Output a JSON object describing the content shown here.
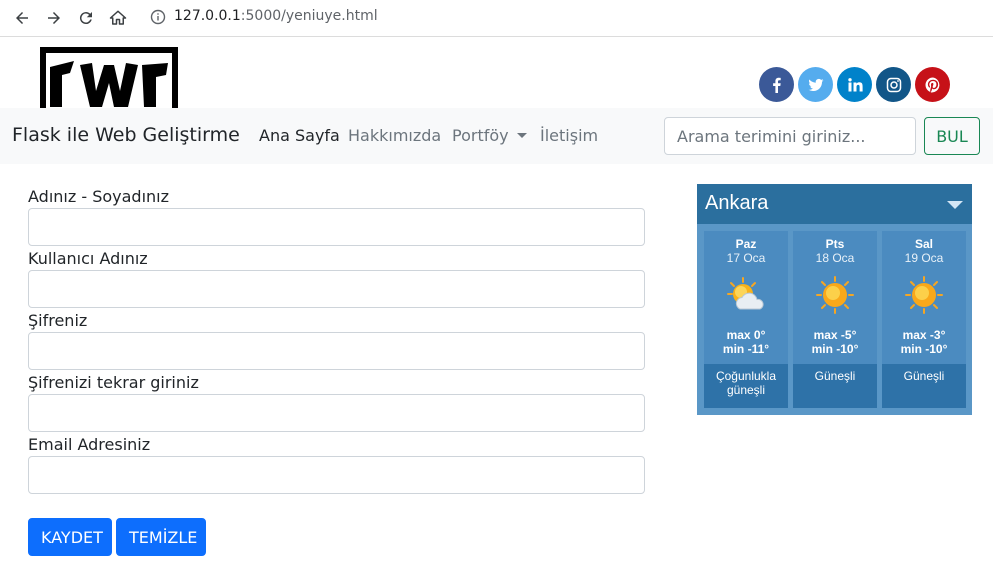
{
  "browser": {
    "url_host": "127.0.0.1",
    "url_rest": ":5000/yeniuye.html"
  },
  "header": {
    "social": [
      {
        "icon": "facebook-icon",
        "color": "#3b5998"
      },
      {
        "icon": "twitter-icon",
        "color": "#55acee"
      },
      {
        "icon": "linkedin-icon",
        "color": "#0082ca"
      },
      {
        "icon": "instagram-icon",
        "color": "#125688"
      },
      {
        "icon": "pinterest-icon",
        "color": "#c61118"
      }
    ]
  },
  "navbar": {
    "brand": "Flask ile Web Geliştirme",
    "links": [
      "Ana Sayfa",
      "Hakkımızda",
      "Portföy",
      "İletişim"
    ],
    "search_placeholder": "Arama terimini giriniz...",
    "search_button": "BUL"
  },
  "form": {
    "labels": [
      "Adınız - Soyadınız",
      "Kullanıcı Adınız",
      "Şifreniz",
      "Şifrenizi tekrar giriniz",
      "Email Adresiniz"
    ],
    "save_button": "KAYDET",
    "clear_button": "TEMİZLE"
  },
  "weather": {
    "city": "Ankara",
    "days": [
      {
        "name": "Paz",
        "date": "17 Oca",
        "max": "max 0°",
        "min": "min -11°",
        "desc": "Çoğunlukla güneşli",
        "icon": "partly-sunny-icon"
      },
      {
        "name": "Pts",
        "date": "18 Oca",
        "max": "max -5°",
        "min": "min -10°",
        "desc": "Güneşli",
        "icon": "sun-icon"
      },
      {
        "name": "Sal",
        "date": "19 Oca",
        "max": "max -3°",
        "min": "min -10°",
        "desc": "Güneşli",
        "icon": "sun-icon"
      }
    ]
  }
}
